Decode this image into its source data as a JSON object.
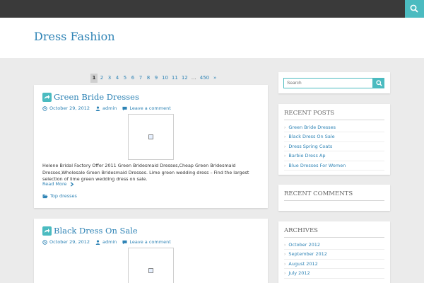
{
  "site": {
    "title": "Dress Fashion"
  },
  "colors": {
    "accent": "#4bbbc0",
    "link": "#2e83b5",
    "topbar": "#3a3a3a",
    "background": "#ebebeb"
  },
  "pagination": [
    "1",
    "2",
    "3",
    "4",
    "5",
    "6",
    "7",
    "8",
    "9",
    "10",
    "11",
    "12",
    "…",
    "450",
    "»"
  ],
  "posts": [
    {
      "title": "Green Bride Dresses",
      "date": "October 29, 2012",
      "author": "admin",
      "comments": "Leave a comment",
      "excerpt": "Helene Bridal Factory Offer 2011 Green Bridesmaid Dresses,Cheap Green Bridesmaid Dresses,Wholesale Green Bridesmaid Dresses. Lime green wedding dress – Find the largest selection of lime green wedding dress on sale.",
      "read_more": "Read More",
      "category": "Top dresses"
    },
    {
      "title": "Black Dress On Sale",
      "date": "October 29, 2012",
      "author": "admin",
      "comments": "Leave a comment"
    }
  ],
  "sidebar": {
    "search_placeholder": "Search",
    "recent_posts": {
      "title": "RECENT POSTS",
      "items": [
        "Green Bride Dresses",
        "Black Dress On Sale",
        "Dress Spring Coats",
        "Barbie Dress Ap",
        "Blue Dresses For Women"
      ]
    },
    "recent_comments": {
      "title": "RECENT COMMENTS"
    },
    "archives": {
      "title": "ARCHIVES",
      "items": [
        "October 2012",
        "September 2012",
        "August 2012",
        "July 2012"
      ]
    }
  }
}
